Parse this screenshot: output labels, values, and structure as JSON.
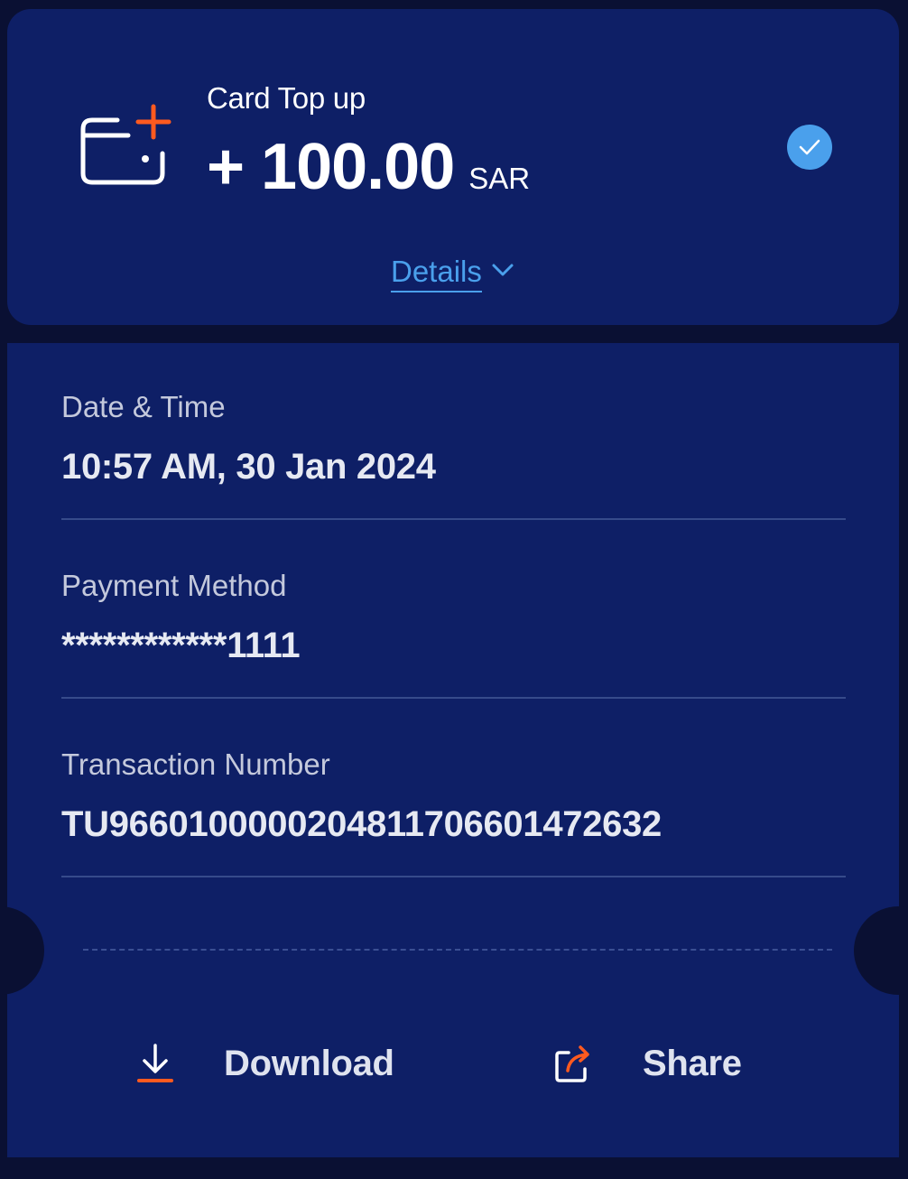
{
  "transaction": {
    "title": "Card Top up",
    "amount": "+ 100.00",
    "currency": "SAR",
    "status": "completed",
    "details_label": "Details"
  },
  "fields": {
    "date_time": {
      "label": "Date & Time",
      "value": "10:57 AM, 30 Jan 2024"
    },
    "payment_method": {
      "label": "Payment Method",
      "value": "************1111"
    },
    "transaction_number": {
      "label": "Transaction Number",
      "value": "TU966010000020481170660147263​2"
    }
  },
  "actions": {
    "download_label": "Download",
    "share_label": "Share"
  },
  "icons": {
    "card_topup": "card-plus-icon",
    "status": "check-circle-icon",
    "details": "chevron-down-icon",
    "download": "download-icon",
    "share": "share-icon"
  },
  "colors": {
    "background": "#0a1033",
    "card": "#0e1f66",
    "accent_blue": "#4aa0ec",
    "accent_orange": "#ff5a1f"
  }
}
